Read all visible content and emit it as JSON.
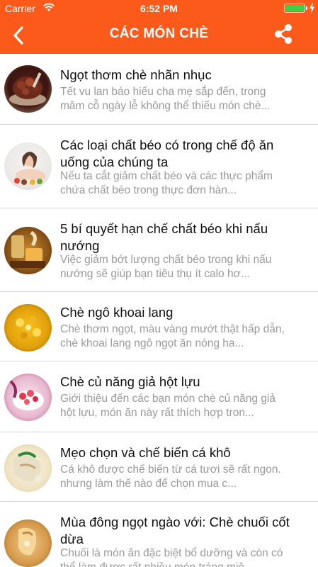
{
  "status_bar": {
    "carrier": "Carrier",
    "time": "6:52 PM",
    "wifi_icon": "wifi-icon",
    "battery_icon": "battery-icon",
    "charging_icon": "bolt-icon"
  },
  "nav": {
    "title": "CÁC MÓN CHÈ",
    "back_icon": "chevron-left-icon",
    "share_icon": "share-icon",
    "accent_color": "#fb5a1b"
  },
  "items": [
    {
      "title": "Ngọt thơm chè nhãn nhục",
      "desc": "Tết vu lan báo hiếu cha mẹ sắp đến, trong mâm cỗ ngày lễ không thể thiếu món chè..."
    },
    {
      "title": "Các loại chất béo có trong chế độ ăn uống của chúng ta",
      "desc": "Nếu ta cắt giảm chất béo và các thực phẩm chứa chất béo trong thực đơn hàn..."
    },
    {
      "title": "5 bí quyết hạn chế chất béo khi nấu nướng",
      "desc": "Việc giảm bớt lượng chất béo trong khi nấu nướng sẽ giúp bạn tiêu thụ ít calo hơ..."
    },
    {
      "title": "Chè ngô khoai lang",
      "desc": "Chè thơm ngọt, màu vàng mướt thật hấp dẫn, chè khoai lang ngô ngọt ăn nóng ha..."
    },
    {
      "title": "Chè củ năng giả hột lựu",
      "desc": "Giới thiệu đến các bạn món chè củ năng giả hột lựu, món ăn này rất thích hợp tron..."
    },
    {
      "title": "Mẹo chọn và chế biến cá khô",
      "desc": "Cá khô được chế biến từ cá tươi sẽ rất ngon. nhưng làm thế nào để chọn mua c..."
    },
    {
      "title": "Mùa đông ngọt ngào với: Chè chuối cốt dừa",
      "desc": "Chuối là món ăn đặc biệt bổ dưỡng và còn có thể làm được rất nhiều món tráng miệ..."
    }
  ]
}
